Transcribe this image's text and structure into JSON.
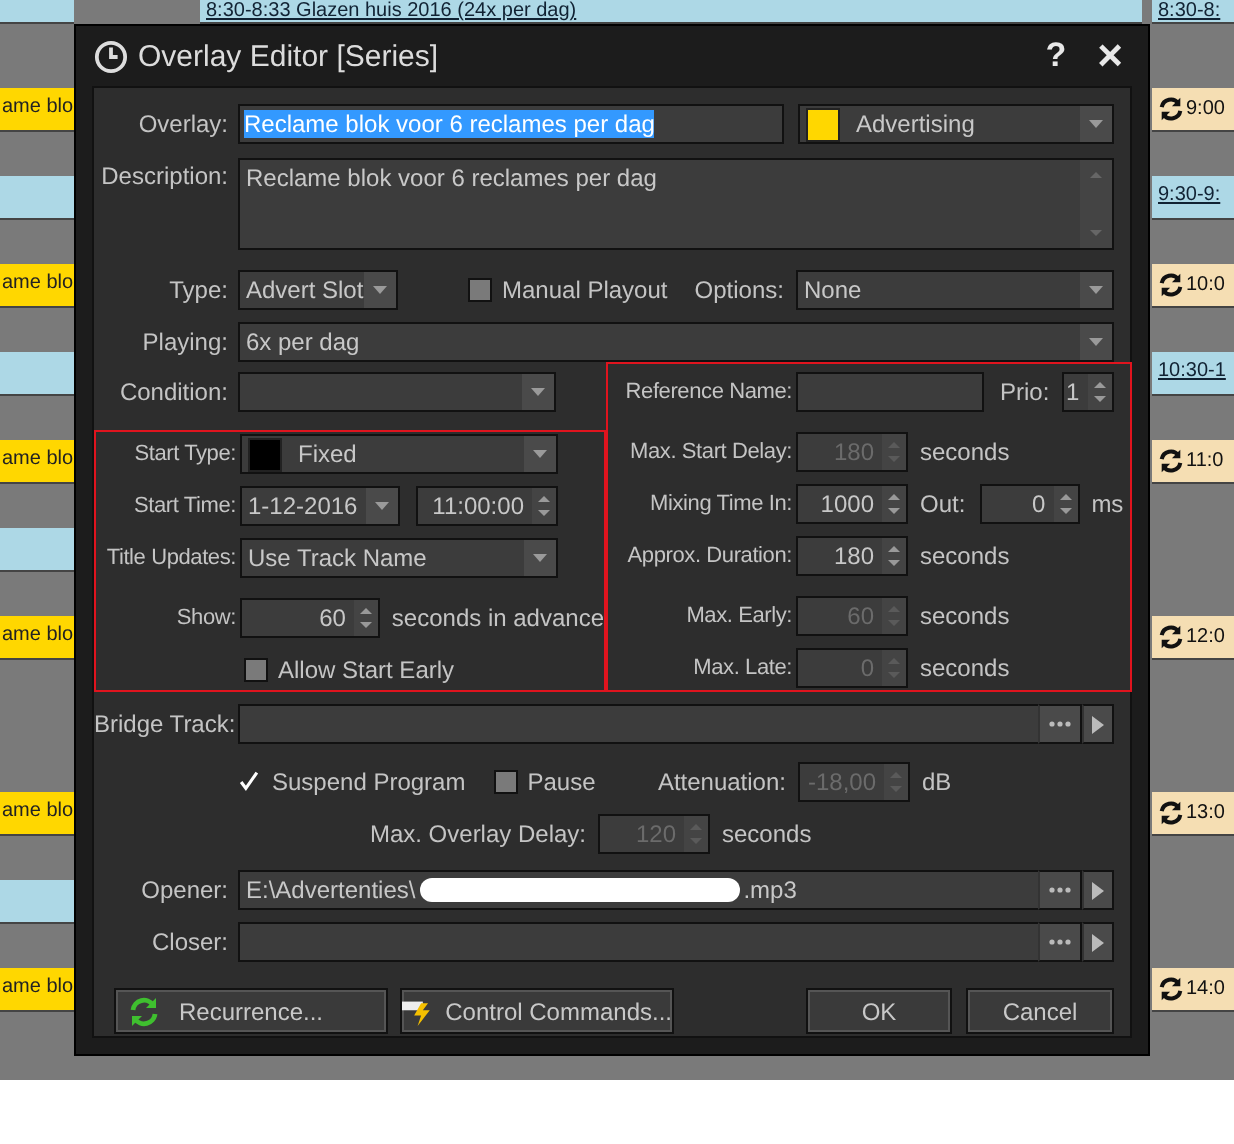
{
  "schedule": {
    "top_event": "8:30-8:33 Glazen huis 2016 (24x per dag)",
    "left_column": [
      {
        "kind": "program"
      },
      {
        "kind": "advert",
        "text": "ame blo"
      },
      {
        "kind": "program"
      },
      {
        "kind": "advert",
        "text": "ame blo"
      },
      {
        "kind": "program"
      },
      {
        "kind": "advert",
        "text": "ame blo"
      },
      {
        "kind": "program"
      },
      {
        "kind": "advert",
        "text": "ame blo"
      },
      {
        "kind": "empty"
      },
      {
        "kind": "advert",
        "text": "ame blo"
      },
      {
        "kind": "program"
      },
      {
        "kind": "advert",
        "text": "ame blo"
      }
    ],
    "right_column": [
      {
        "kind": "program",
        "text": "8:30-8:"
      },
      {
        "kind": "advert",
        "text": "9:00"
      },
      {
        "kind": "program",
        "text": "9:30-9:"
      },
      {
        "kind": "advert",
        "text": "10:0"
      },
      {
        "kind": "program",
        "text": "10:30-1"
      },
      {
        "kind": "advert",
        "text": "11:0"
      },
      {
        "kind": "empty"
      },
      {
        "kind": "advert",
        "text": "12:0"
      },
      {
        "kind": "empty"
      },
      {
        "kind": "advert",
        "text": "13:0"
      },
      {
        "kind": "empty"
      },
      {
        "kind": "advert",
        "text": "14:0"
      }
    ]
  },
  "dialog": {
    "title": "Overlay Editor [Series]",
    "help_button": "?",
    "close_button": "×",
    "overlay": {
      "label": "Overlay:",
      "value": "Reclame blok voor 6 reclames per dag",
      "text_selected": true
    },
    "category": {
      "value": "Advertising",
      "color": "#ffd700"
    },
    "description": {
      "label": "Description:",
      "value": "Reclame blok voor 6 reclames per dag"
    },
    "type": {
      "label": "Type:",
      "value": "Advert Slot"
    },
    "manual_playout": {
      "label": "Manual Playout",
      "checked": false
    },
    "options": {
      "label": "Options:",
      "value": "None"
    },
    "playing": {
      "label": "Playing:",
      "value": "6x per dag"
    },
    "condition": {
      "label": "Condition:"
    },
    "start_type": {
      "label": "Start Type:",
      "value": "Fixed",
      "color": "#000000"
    },
    "start_time": {
      "label": "Start Time:",
      "date": "1-12-2016",
      "time": "11:00:00"
    },
    "title_updates": {
      "label": "Title Updates:",
      "value": "Use Track Name"
    },
    "show": {
      "label": "Show:",
      "value": "60",
      "unit": "seconds in advance",
      "disabled": false
    },
    "allow_start_early": {
      "label": "Allow Start Early",
      "checked": false
    },
    "reference_name": {
      "label": "Reference Name:"
    },
    "prio": {
      "label": "Prio:",
      "value": "1",
      "disabled": false
    },
    "max_start_delay": {
      "label": "Max. Start Delay:",
      "value": "180",
      "unit": "seconds",
      "disabled": true
    },
    "mixing_time_in": {
      "label": "Mixing Time In:",
      "value": "1000",
      "disabled": false
    },
    "mixing_out": {
      "label": "Out:",
      "value": "0",
      "unit": "ms",
      "disabled": false
    },
    "approx_duration": {
      "label": "Approx. Duration:",
      "value": "180",
      "unit": "seconds",
      "disabled": false
    },
    "max_early": {
      "label": "Max. Early:",
      "value": "60",
      "unit": "seconds",
      "disabled": true
    },
    "max_late": {
      "label": "Max. Late:",
      "value": "0",
      "unit": "seconds",
      "disabled": true
    },
    "bridge_track": {
      "label": "Bridge Track:"
    },
    "suspend_program": {
      "label": "Suspend Program",
      "checked": true
    },
    "pause": {
      "label": "Pause",
      "checked": false
    },
    "attenuation": {
      "label": "Attenuation:",
      "value": "-18,00",
      "unit": "dB",
      "disabled": true
    },
    "max_overlay_delay": {
      "label": "Max. Overlay Delay:",
      "value": "120",
      "unit": "seconds",
      "disabled": true
    },
    "opener": {
      "label": "Opener:",
      "value_start": "E:\\Advertenties\\",
      "redacted": true,
      "value_end": ".mp3"
    },
    "closer": {
      "label": "Closer:"
    },
    "buttons": [
      {
        "kind": "recurrence",
        "label": "Recurrence..."
      },
      {
        "kind": "commands",
        "label": "Control Commands..."
      },
      {
        "kind": "ok",
        "label": "OK"
      },
      {
        "kind": "cancel",
        "label": "Cancel"
      }
    ]
  }
}
